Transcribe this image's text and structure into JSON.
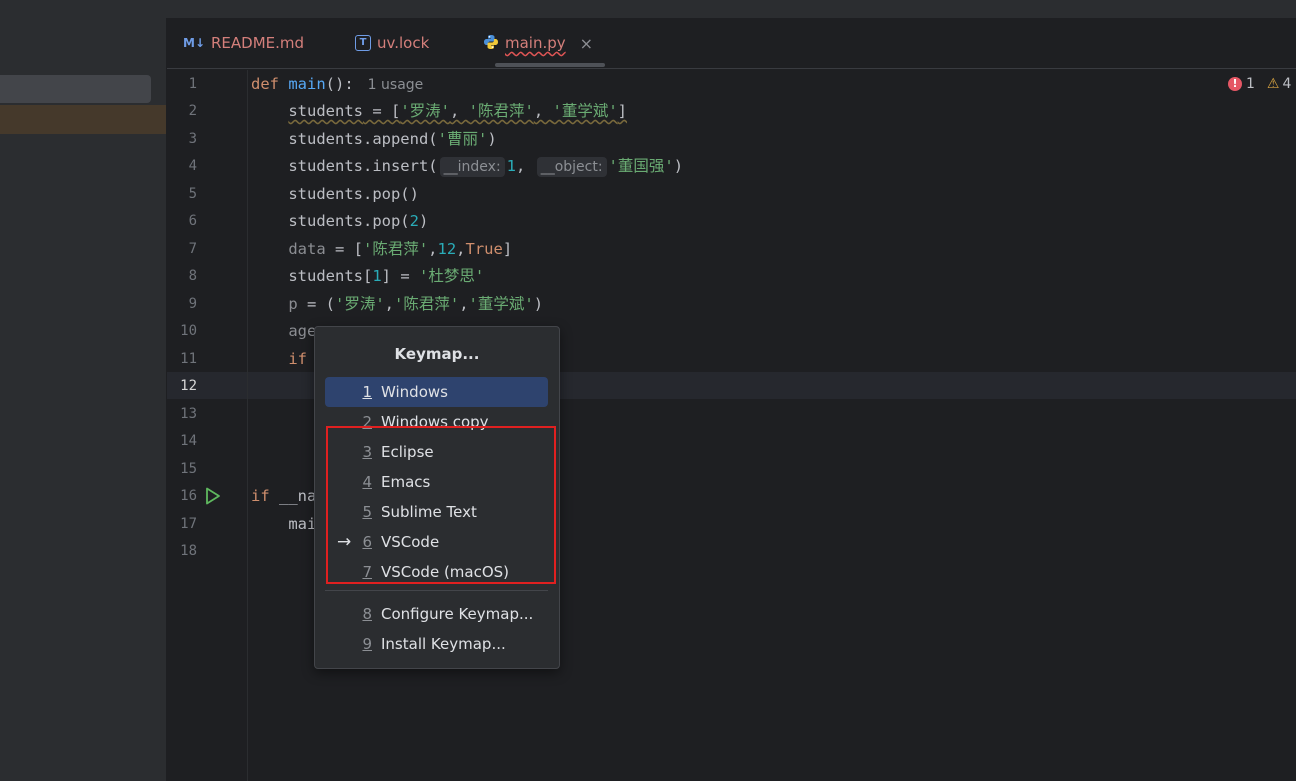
{
  "tabs": [
    {
      "icon": "M↓",
      "label": "README.md"
    },
    {
      "icon": "T",
      "label": "uv.lock"
    },
    {
      "icon": "python-icon",
      "label": "main.py",
      "close": "×"
    }
  ],
  "inspections": {
    "errors": "1",
    "warnings": "4"
  },
  "line_numbers": [
    "1",
    "2",
    "3",
    "4",
    "5",
    "6",
    "7",
    "8",
    "9",
    "10",
    "11",
    "12",
    "13",
    "14",
    "15",
    "16",
    "17",
    "18"
  ],
  "code": {
    "l1_def": "def",
    "l1_name": "main",
    "l1_rest": "():",
    "l1_hint": "1 usage",
    "l2_var": "students",
    "l2_eq": " = [",
    "l2_s1": "'罗涛'",
    "l2_c1": ", ",
    "l2_s2": "'陈君萍'",
    "l2_c2": ", ",
    "l2_s3": "'董学斌'",
    "l2_end": "]",
    "l3_a": "students.append(",
    "l3_s": "'曹丽'",
    "l3_b": ")",
    "l4_a": "students.insert(",
    "l4_p1": "__index:",
    "l4_n": "1",
    "l4_c": ", ",
    "l4_p2": "__object:",
    "l4_s": "'董国强'",
    "l4_b": ")",
    "l5": "students.pop()",
    "l6_a": "students.pop(",
    "l6_n": "2",
    "l6_b": ")",
    "l7_var": "data",
    "l7_a": " = [",
    "l7_s": "'陈君萍'",
    "l7_c1": ",",
    "l7_n": "12",
    "l7_c2": ",",
    "l7_t": "True",
    "l7_b": "]",
    "l8_a": "students[",
    "l8_n": "1",
    "l8_b": "] = ",
    "l8_s": "'杜梦思'",
    "l9_var": "p",
    "l9_a": " = (",
    "l9_s1": "'罗涛'",
    "l9_c1": ",",
    "l9_s2": "'陈君萍'",
    "l9_c2": ",",
    "l9_s3": "'董学斌'",
    "l9_b": ")",
    "l10": "age",
    "l11": "if",
    "l16_if": "if",
    "l16_rest": " __na",
    "l17": "mai"
  },
  "popup": {
    "title": "Keymap...",
    "items": [
      {
        "num": "1",
        "label": "Windows"
      },
      {
        "num": "2",
        "label": "Windows copy"
      },
      {
        "num": "3",
        "label": "Eclipse"
      },
      {
        "num": "4",
        "label": "Emacs"
      },
      {
        "num": "5",
        "label": "Sublime Text"
      },
      {
        "num": "6",
        "label": "VSCode",
        "marker": "→"
      },
      {
        "num": "7",
        "label": "VSCode (macOS)"
      },
      {
        "num": "8",
        "label": "Configure Keymap..."
      },
      {
        "num": "9",
        "label": "Install Keymap..."
      }
    ]
  },
  "colors": {
    "accent_selection": "#2e436e",
    "highlight_box": "#e02020",
    "error": "#e55765",
    "warning": "#d9a441"
  }
}
